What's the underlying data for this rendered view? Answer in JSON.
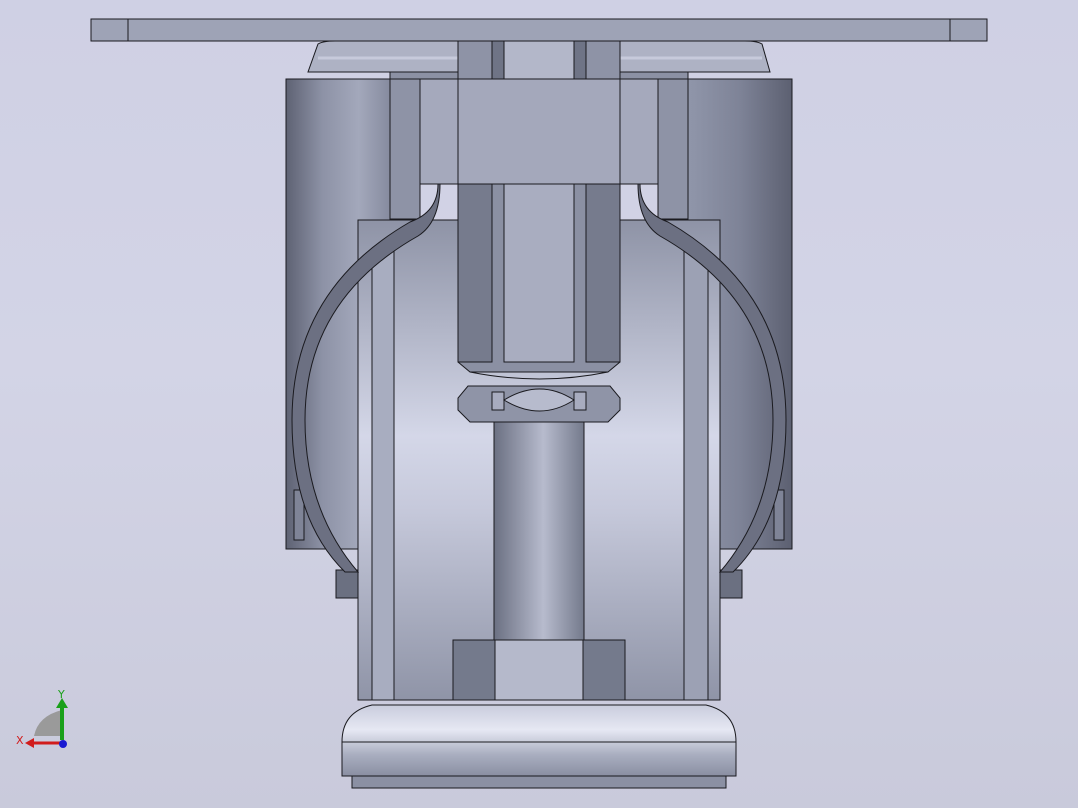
{
  "view": {
    "model": "caster-wheel-assembly",
    "colors": {
      "background_top": "#cfd0e4",
      "background_bottom": "#c9cadb",
      "part_light": "#c4c7d9",
      "part_mid": "#9a9fb3",
      "part_dark": "#5a5e6e",
      "edge": "#1a1a1f"
    }
  },
  "triad": {
    "x_label": "X",
    "y_label": "Y",
    "x_color": "#d11c1c",
    "y_color": "#1aa01a",
    "z_color": "#1a1ad1"
  }
}
